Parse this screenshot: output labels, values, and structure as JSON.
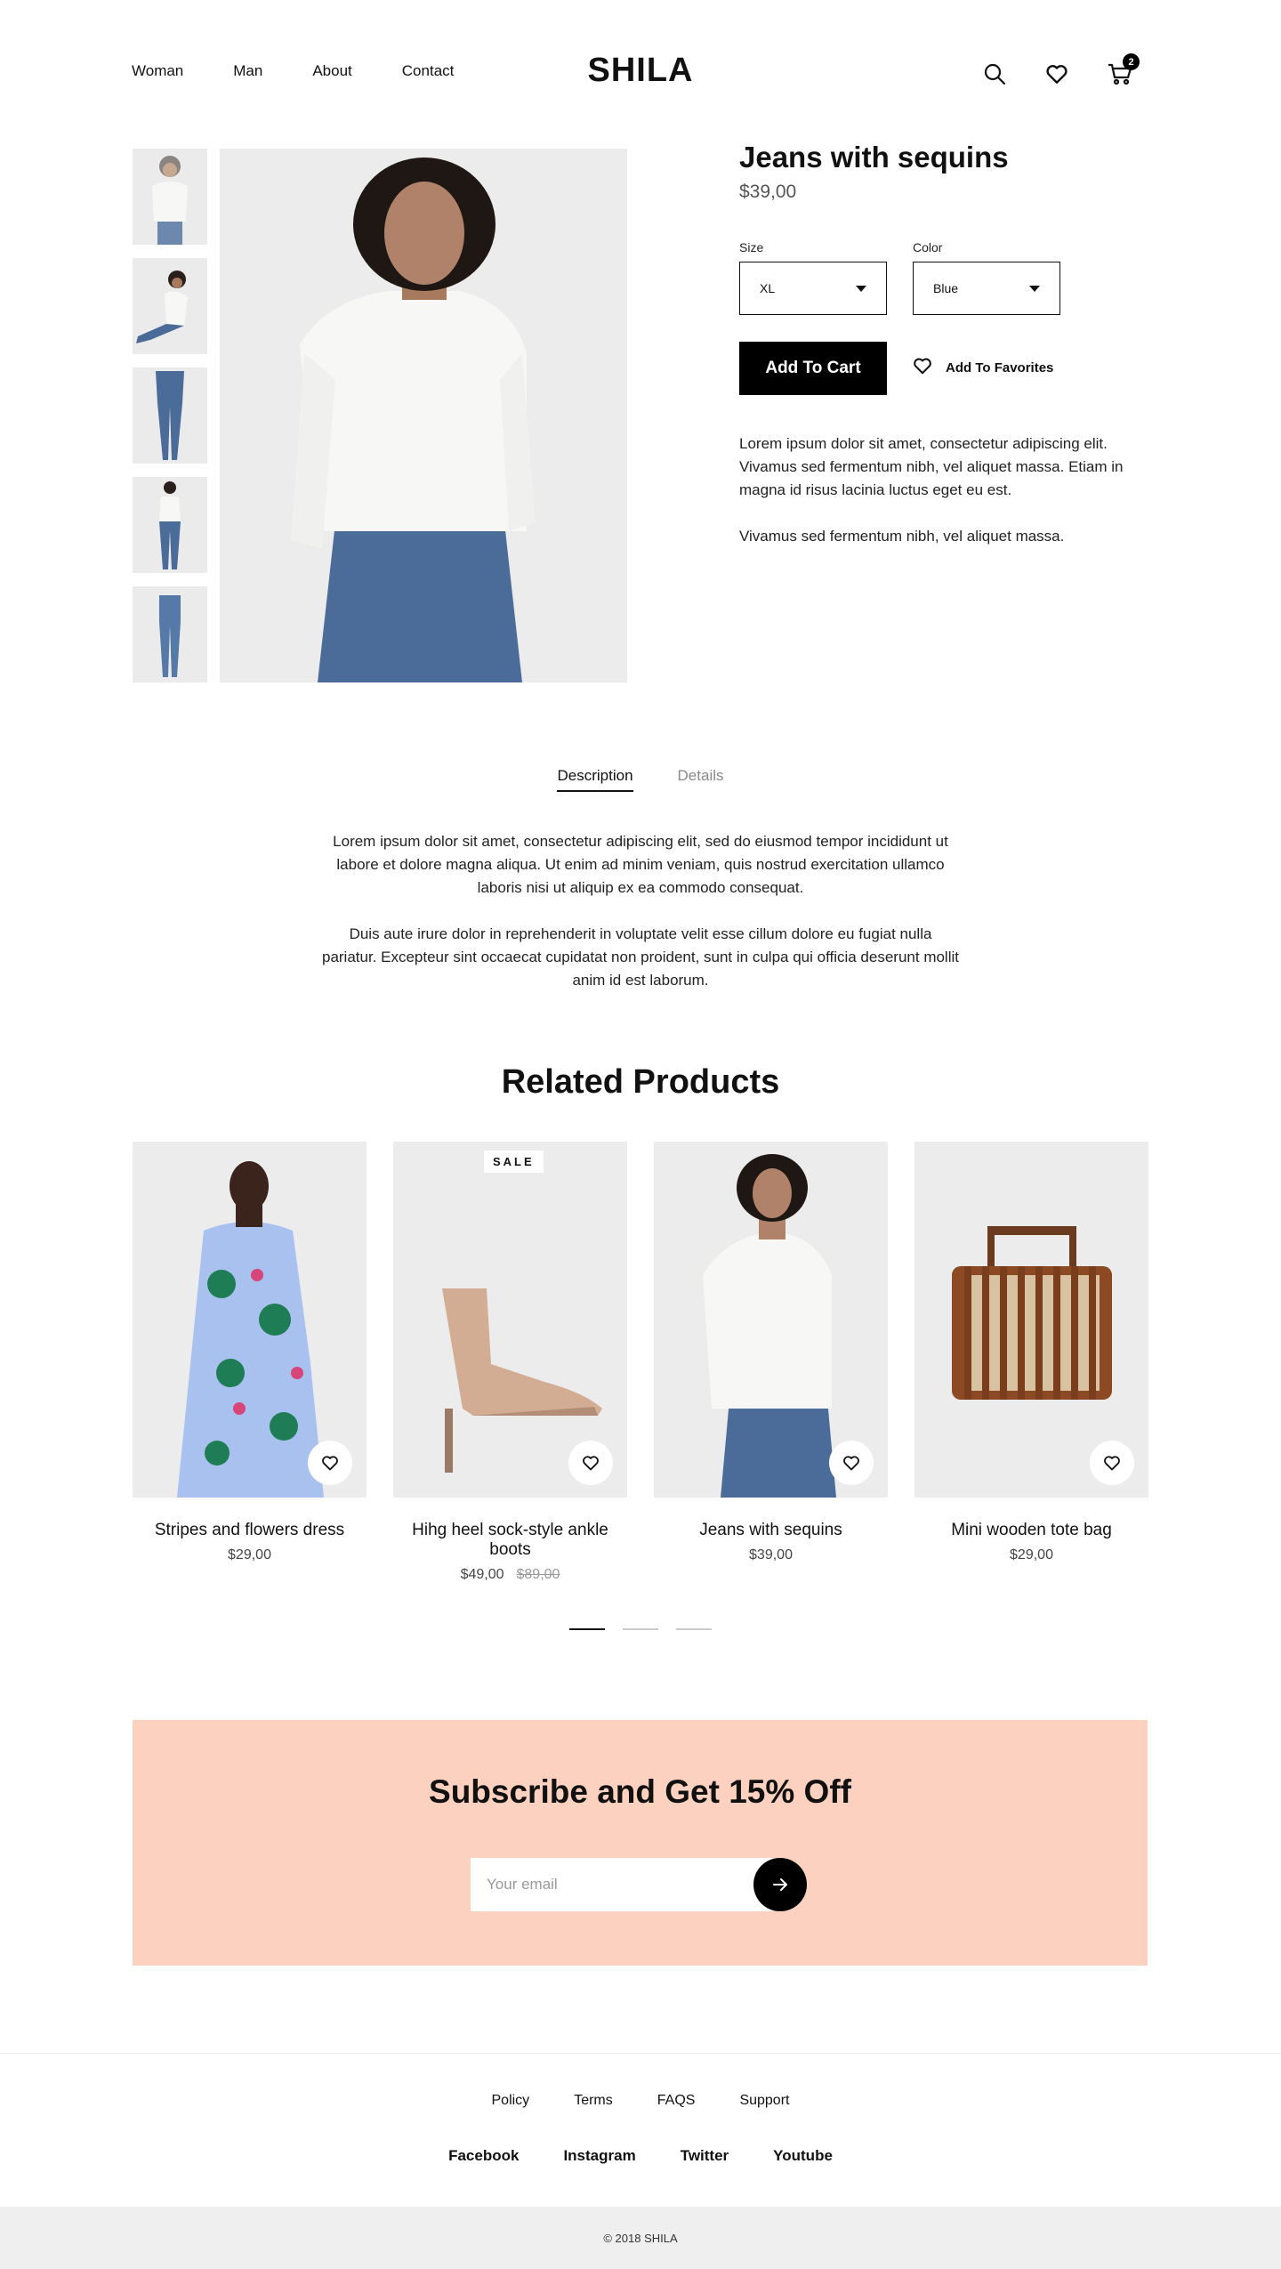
{
  "header": {
    "nav": [
      "Woman",
      "Man",
      "About",
      "Contact"
    ],
    "logo": "SHILA",
    "cart_count": "2"
  },
  "product": {
    "title": "Jeans with sequins",
    "price": "$39,00",
    "size_label": "Size",
    "size_value": "XL",
    "color_label": "Color",
    "color_value": "Blue",
    "add_to_cart": "Add To Cart",
    "add_to_favorites": "Add To Favorites",
    "description": [
      "Lorem ipsum dolor sit amet, consectetur adipiscing elit. Vivamus sed fermentum nibh, vel aliquet massa. Etiam in magna id risus lacinia luctus eget eu est.",
      "Vivamus sed fermentum nibh, vel aliquet massa."
    ]
  },
  "tabs": {
    "items": [
      "Description",
      "Details"
    ],
    "active": "Description",
    "text": [
      "Lorem ipsum dolor sit amet, consectetur adipiscing elit, sed do eiusmod tempor incididunt ut labore et dolore magna aliqua. Ut enim ad minim veniam, quis nostrud exercitation ullamco laboris nisi ut aliquip ex ea commodo consequat.",
      "Duis aute irure dolor in reprehenderit in voluptate velit esse cillum dolore eu fugiat nulla pariatur. Excepteur sint occaecat cupidatat non proident, sunt in culpa qui officia deserunt mollit anim id est laborum."
    ]
  },
  "related": {
    "title": "Related Products",
    "items": [
      {
        "name": "Stripes and flowers dress",
        "price": "$29,00",
        "old_price": "",
        "badge": ""
      },
      {
        "name": "Hihg heel sock-style ankle boots",
        "price": "$49,00",
        "old_price": "$89,00",
        "badge": "SALE"
      },
      {
        "name": "Jeans with sequins",
        "price": "$39,00",
        "old_price": "",
        "badge": ""
      },
      {
        "name": "Mini wooden tote bag",
        "price": "$29,00",
        "old_price": "",
        "badge": ""
      }
    ]
  },
  "subscribe": {
    "title": "Subscribe and Get 15% Off",
    "placeholder": "Your email"
  },
  "footer": {
    "links": [
      "Policy",
      "Terms",
      "FAQS",
      "Support"
    ],
    "social": [
      "Facebook",
      "Instagram",
      "Twitter",
      "Youtube"
    ],
    "copyright": "© 2018 SHILA"
  },
  "colors": {
    "subscribe_bg": "#fdd1bf",
    "primary": "#000000",
    "image_bg": "#ececec",
    "footer_bg": "#efefef"
  }
}
